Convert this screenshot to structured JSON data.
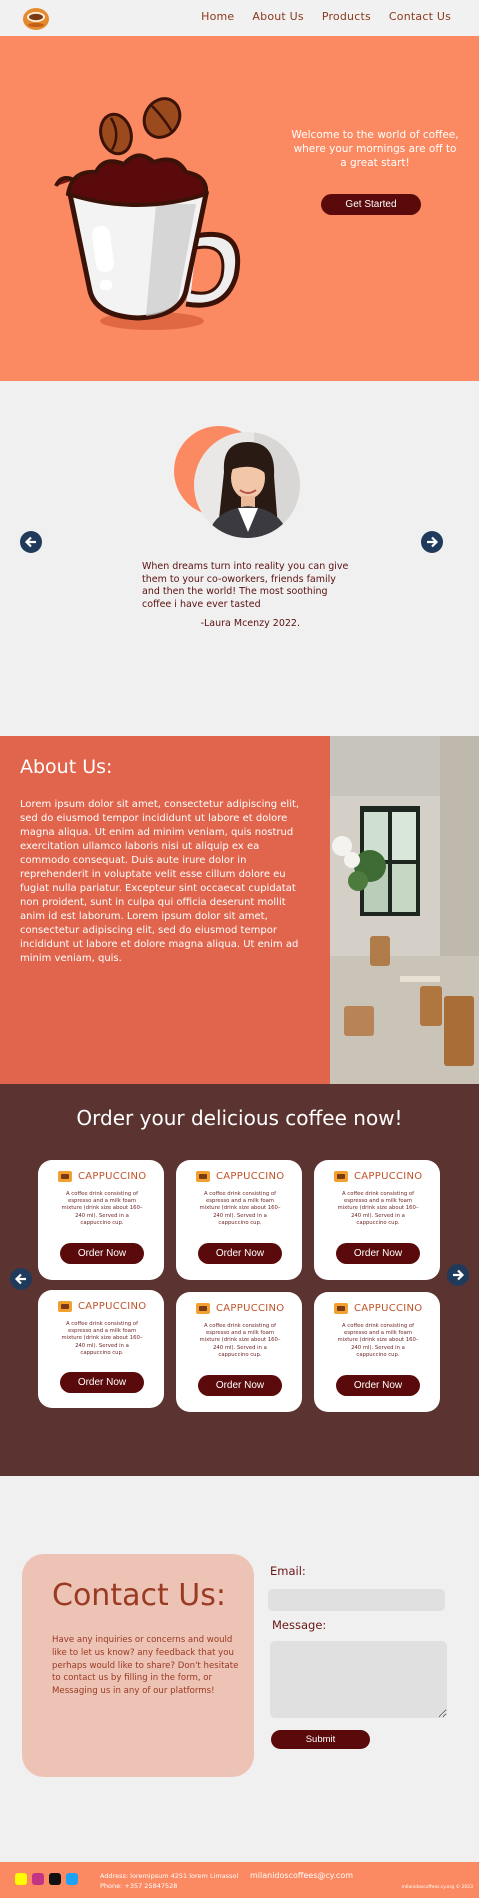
{
  "nav": {
    "links": [
      "Home",
      "About Us",
      "Products",
      "Contact Us"
    ]
  },
  "hero": {
    "welcome": "Welcome to the world of coffee, where your mornings are off to a great start!",
    "button": "Get Started"
  },
  "testimonial": {
    "quote": "When dreams turn into reality you can give them to your co-oworkers, friends family and then the world! The most soothing coffee i have ever tasted",
    "author": "-Laura Mcenzy 2022."
  },
  "about": {
    "title": "About Us:",
    "text": "Lorem ipsum dolor sit amet, consectetur adipiscing elit, sed do eiusmod tempor incididunt ut labore et dolore magna aliqua. Ut enim ad minim veniam, quis nostrud exercitation ullamco laboris nisi ut aliquip ex ea commodo consequat. Duis aute irure dolor in reprehenderit in voluptate velit esse cillum dolore eu fugiat nulla pariatur. Excepteur sint occaecat cupidatat non proident, sunt in culpa qui officia deserunt mollit anim id est laborum. Lorem ipsum dolor sit amet, consectetur adipiscing elit, sed do eiusmod tempor incididunt ut labore et dolore magna aliqua. Ut enim ad minim veniam, quis."
  },
  "order": {
    "title": "Order your delicious coffee now!",
    "cards": [
      {
        "title": "CAPPUCCINO",
        "desc": "A coffee drink consisting of espresso and a milk foam mixture (drink size about 160–240 ml). Served in a cappuccino cup.",
        "button": "Order Now"
      },
      {
        "title": "CAPPUCCINO",
        "desc": "A coffee drink consisting of espresso and a milk foam mixture (drink size about 160–240 ml). Served in a cappuccino cup.",
        "button": "Order Now"
      },
      {
        "title": "CAPPUCCINO",
        "desc": "A coffee drink consisting of espresso and a milk foam mixture (drink size about 160–240 ml). Served in a cappuccino cup.",
        "button": "Order Now"
      },
      {
        "title": "CAPPUCCINO",
        "desc": "A coffee drink consisting of espresso and a milk foam mixture (drink size about 160–240 ml). Served in a cappuccino cup.",
        "button": "Order Now"
      },
      {
        "title": "CAPPUCCINO",
        "desc": "A coffee drink consisting of espresso and a milk foam mixture (drink size about 160–240 ml). Served in a cappuccino cup.",
        "button": "Order Now"
      },
      {
        "title": "CAPPUCCINO",
        "desc": "A coffee drink consisting of espresso and a milk foam mixture (drink size about 160–240 ml). Served in a cappuccino cup.",
        "button": "Order Now"
      }
    ]
  },
  "contact": {
    "title": "Contact Us:",
    "text": "Have any inquiries or concerns and would like to let us know? any feedback that you perhaps would like to share? Don't hesitate to contact us by filling in the form, or Messaging us in any of our platforms!",
    "email_label": "Email:",
    "message_label": "Message:",
    "submit": "Submit"
  },
  "footer": {
    "address": "Address: loremipsum 4251 lorem Limassol",
    "phone": "Phone: +357 25847528",
    "email": "milanidoscoffees@cy.com",
    "copyright": "milanidoscoffees.cy.org © 2023"
  },
  "colors": {
    "accent": "#fb8a62",
    "dark": "#5a0a0a",
    "about_bg": "#e0654c",
    "order_bg": "#5b3431",
    "arrow": "#1f3a5a"
  }
}
